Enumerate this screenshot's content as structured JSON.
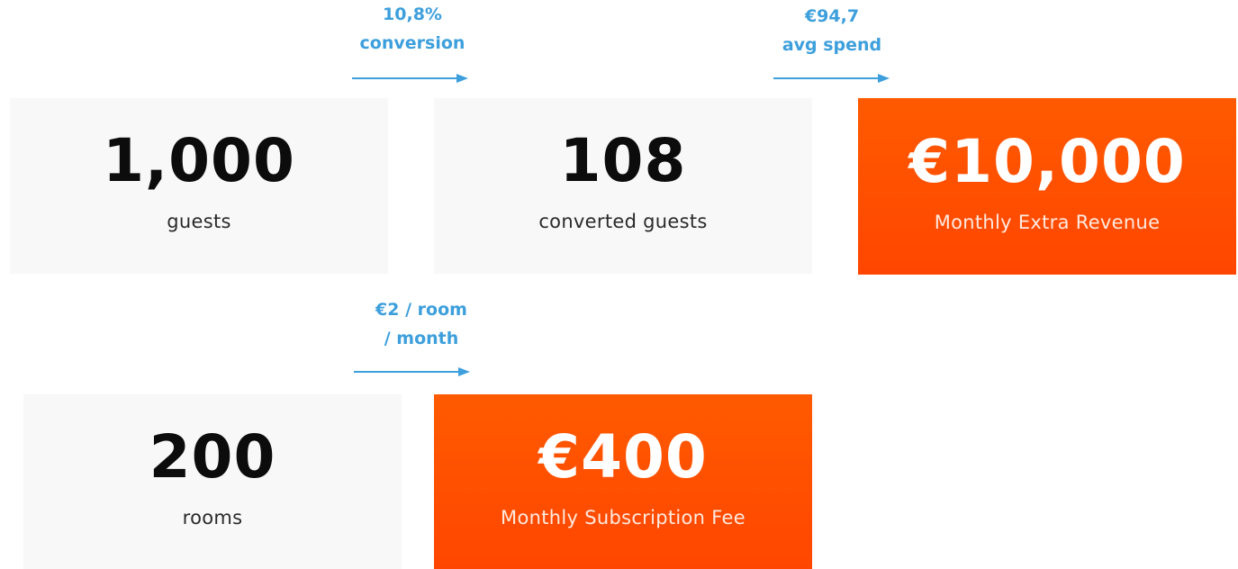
{
  "colors": {
    "accent": "#3d9fdc",
    "highlight": "#ff5200",
    "card_bg": "#f8f8f8"
  },
  "row1": {
    "guests": {
      "value": "1,000",
      "label": "guests"
    },
    "conversion": {
      "line1": "10,8%",
      "line2": "conversion"
    },
    "converted": {
      "value": "108",
      "label": "converted guests"
    },
    "spend": {
      "line1": "€94,7",
      "line2": "avg spend"
    },
    "revenue": {
      "value": "€10,000",
      "label": "Monthly Extra Revenue"
    }
  },
  "row2": {
    "rooms": {
      "value": "200",
      "label": "rooms"
    },
    "price": {
      "line1": "€2 / room",
      "line2": "/ month"
    },
    "fee": {
      "value": "€400",
      "label": "Monthly Subscription Fee"
    }
  }
}
